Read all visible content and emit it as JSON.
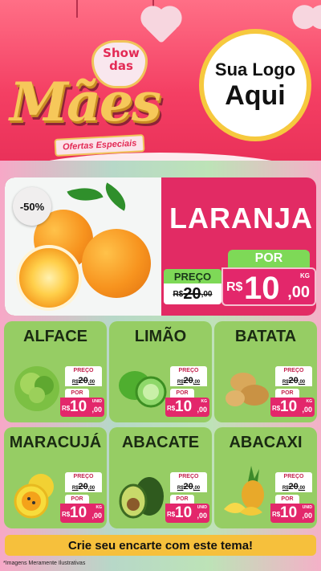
{
  "header": {
    "title_show": "Show das",
    "title_main": "Mães",
    "title_sub": "Ofertas Especiais",
    "logo_line1": "Sua Logo",
    "logo_line2": "Aqui"
  },
  "hero": {
    "discount": "-50%",
    "name": "LARANJA",
    "por_label": "POR",
    "preco_label": "PREÇO",
    "old_currency": "R$",
    "old_value": "20",
    "old_cents": ",00",
    "new_currency": "R$",
    "new_value": "10",
    "new_cents": ",00",
    "unit": "KG"
  },
  "products": [
    {
      "name": "ALFACE",
      "preco_label": "PREÇO",
      "old_currency": "R$",
      "old_value": "20",
      "old_cents": ",00",
      "por_label": "POR",
      "new_currency": "R$",
      "new_value": "10",
      "new_cents": ",00",
      "unit": "UNID"
    },
    {
      "name": "LIMÃO",
      "preco_label": "PREÇO",
      "old_currency": "R$",
      "old_value": "20",
      "old_cents": ",00",
      "por_label": "POR",
      "new_currency": "R$",
      "new_value": "10",
      "new_cents": ",00",
      "unit": "KG"
    },
    {
      "name": "BATATA",
      "preco_label": "PREÇO",
      "old_currency": "R$",
      "old_value": "20",
      "old_cents": ",00",
      "por_label": "POR",
      "new_currency": "R$",
      "new_value": "10",
      "new_cents": ",00",
      "unit": "KG"
    },
    {
      "name": "MARACUJÁ",
      "preco_label": "PREÇO",
      "old_currency": "R$",
      "old_value": "20",
      "old_cents": ",00",
      "por_label": "POR",
      "new_currency": "R$",
      "new_value": "10",
      "new_cents": ",00",
      "unit": "KG"
    },
    {
      "name": "ABACATE",
      "preco_label": "PREÇO",
      "old_currency": "R$",
      "old_value": "20",
      "old_cents": ",00",
      "por_label": "POR",
      "new_currency": "R$",
      "new_value": "10",
      "new_cents": ",00",
      "unit": "UNID"
    },
    {
      "name": "ABACAXI",
      "preco_label": "PREÇO",
      "old_currency": "R$",
      "old_value": "20",
      "old_cents": ",00",
      "por_label": "POR",
      "new_currency": "R$",
      "new_value": "10",
      "new_cents": ",00",
      "unit": "UNID"
    }
  ],
  "cta": "Crie seu encarte com este tema!",
  "disclaimer": "*Imagens Meramente Ilustrativas",
  "colors": {
    "header_pink": "#f43f63",
    "hero_magenta": "#e22b64",
    "card_green": "#96cd64",
    "price_pink": "#e3276b",
    "tag_green": "#7ed957",
    "cta_yellow": "#f6c03c",
    "logo_ring": "#f6c93e"
  }
}
